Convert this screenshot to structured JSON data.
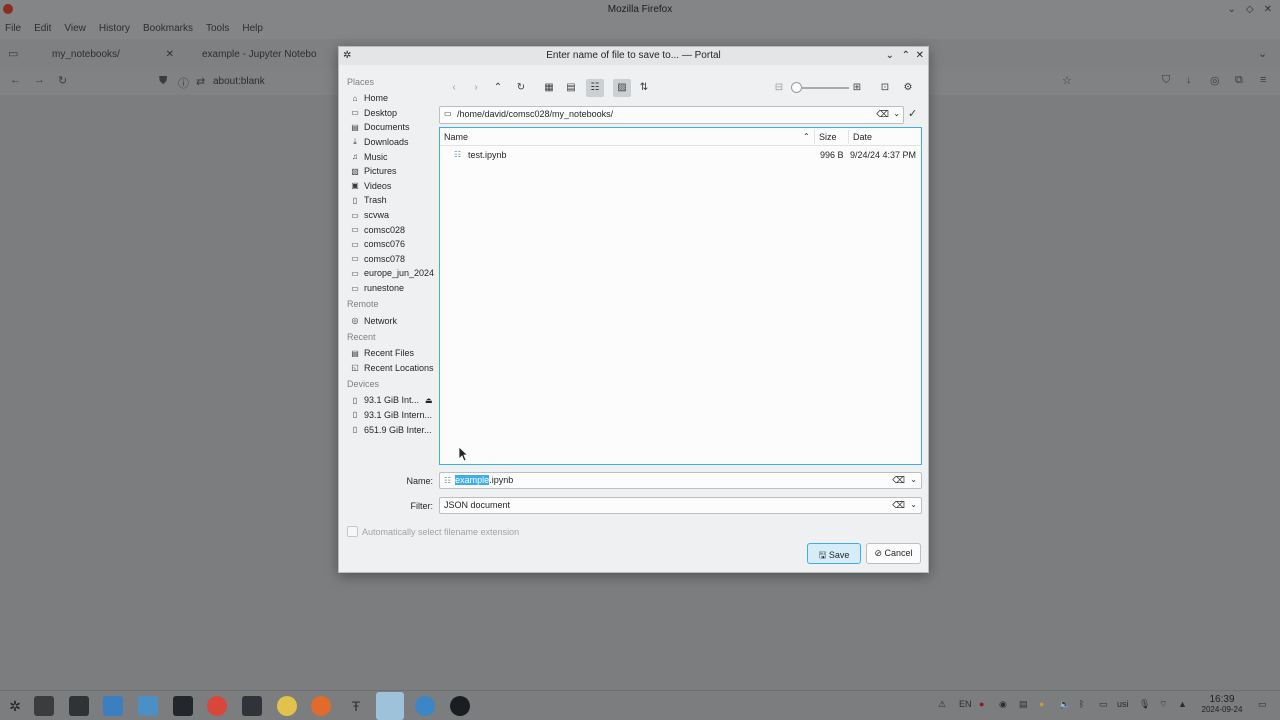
{
  "browser": {
    "window_title": "Mozilla Firefox",
    "menu": [
      "File",
      "Edit",
      "View",
      "History",
      "Bookmarks",
      "Tools",
      "Help"
    ],
    "tabs": [
      {
        "label": "my_notebooks/"
      },
      {
        "label": "example - Jupyter Notebo"
      }
    ],
    "url": "about:blank"
  },
  "dialog": {
    "title": "Enter name of file to save to... — Portal",
    "places": {
      "places_header": "Places",
      "places": [
        {
          "label": "Home",
          "icon": "home-icon"
        },
        {
          "label": "Desktop",
          "icon": "desktop-icon"
        },
        {
          "label": "Documents",
          "icon": "documents-icon"
        },
        {
          "label": "Downloads",
          "icon": "downloads-icon"
        },
        {
          "label": "Music",
          "icon": "music-icon"
        },
        {
          "label": "Pictures",
          "icon": "pictures-icon"
        },
        {
          "label": "Videos",
          "icon": "videos-icon"
        },
        {
          "label": "Trash",
          "icon": "trash-icon"
        },
        {
          "label": "scvwa",
          "icon": "folder-icon"
        },
        {
          "label": "comsc028",
          "icon": "folder-icon"
        },
        {
          "label": "comsc076",
          "icon": "folder-icon"
        },
        {
          "label": "comsc078",
          "icon": "folder-icon"
        },
        {
          "label": "europe_jun_2024",
          "icon": "folder-icon"
        },
        {
          "label": "runestone",
          "icon": "folder-icon"
        }
      ],
      "remote_header": "Remote",
      "remote": [
        {
          "label": "Network",
          "icon": "network-icon"
        }
      ],
      "recent_header": "Recent",
      "recent": [
        {
          "label": "Recent Files",
          "icon": "recent-files-icon"
        },
        {
          "label": "Recent Locations",
          "icon": "recent-locations-icon"
        }
      ],
      "devices_header": "Devices",
      "devices": [
        {
          "label": "93.1 GiB Int...",
          "icon": "drive-icon"
        },
        {
          "label": "93.1 GiB Intern...",
          "icon": "drive-icon"
        },
        {
          "label": "651.9 GiB Inter...",
          "icon": "drive-icon"
        }
      ]
    },
    "path": "/home/david/comsc028/my_notebooks/",
    "columns": {
      "name": "Name",
      "size": "Size",
      "date": "Date"
    },
    "files": [
      {
        "name": "test.ipynb",
        "size": "996 B",
        "date": "9/24/24 4:37 PM"
      }
    ],
    "name_label": "Name:",
    "name_selected": "example",
    "name_rest": ".ipynb",
    "filter_label": "Filter:",
    "filter_value": "JSON document",
    "auto_ext_label": "Automatically select filename extension",
    "save_label": "Save",
    "cancel_label": "Cancel"
  },
  "taskbar": {
    "lang": "EN",
    "user": "usi",
    "time": "16:39",
    "date": "2024-09-24"
  },
  "colors": {
    "accent": "#3daee9",
    "dialog_bg": "#eff0f1",
    "dim_bg": "#7b7d7f"
  }
}
